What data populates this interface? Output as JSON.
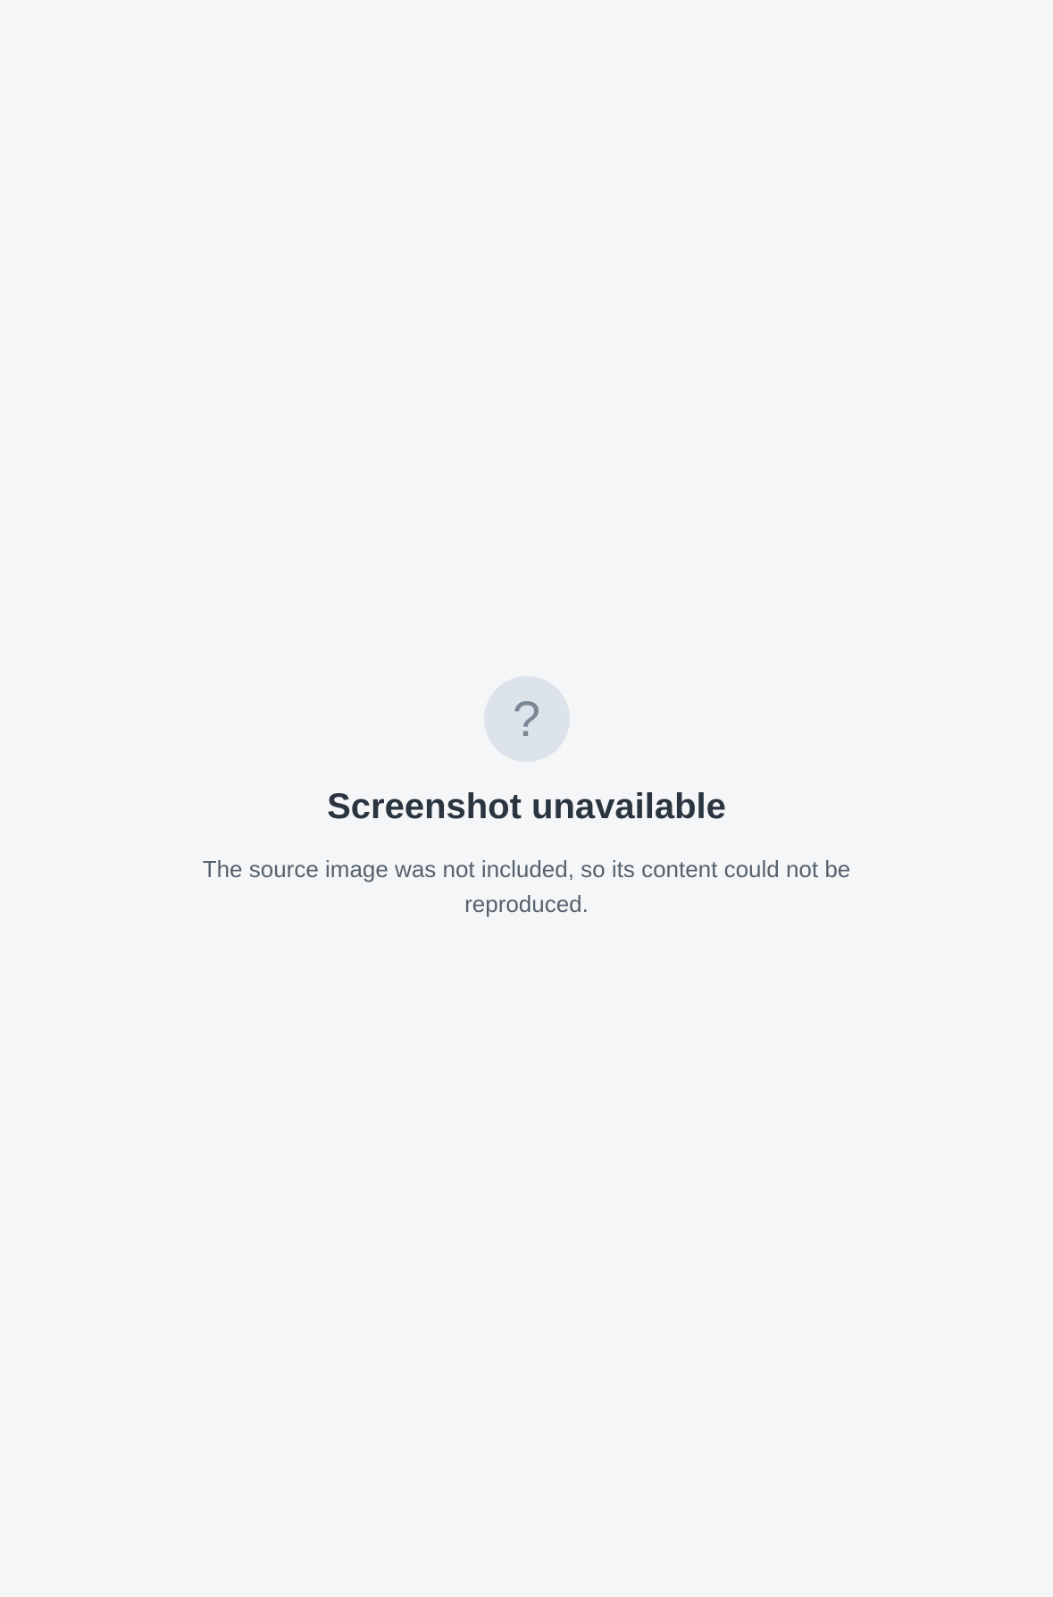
{
  "notice": {
    "icon": "image-icon",
    "icon_glyph": "?",
    "title": "Screenshot unavailable",
    "body": "The source image was not included, so its content could not be reproduced."
  }
}
